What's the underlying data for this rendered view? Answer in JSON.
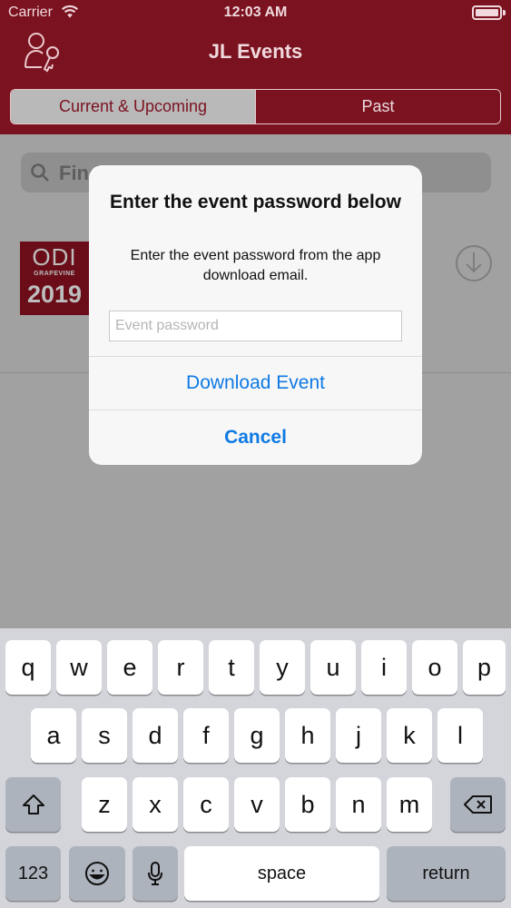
{
  "status_bar": {
    "carrier": "Carrier",
    "time": "12:03 AM"
  },
  "header": {
    "title": "JL Events"
  },
  "tabs": [
    {
      "label": "Current & Upcoming",
      "selected": true
    },
    {
      "label": "Past",
      "selected": false
    }
  ],
  "search": {
    "text": "Find"
  },
  "event": {
    "thumb_line1": "ODI",
    "thumb_line2": "GRAPEVINE",
    "thumb_line3": "2019"
  },
  "alert": {
    "title": "Enter the event password below",
    "message": "Enter the event password from the app download email.",
    "input_placeholder": "Event password",
    "input_value": "",
    "download_label": "Download Event",
    "cancel_label": "Cancel"
  },
  "keyboard": {
    "row1": [
      "q",
      "w",
      "e",
      "r",
      "t",
      "y",
      "u",
      "i",
      "o",
      "p"
    ],
    "row2": [
      "a",
      "s",
      "d",
      "f",
      "g",
      "h",
      "j",
      "k",
      "l"
    ],
    "row3": [
      "z",
      "x",
      "c",
      "v",
      "b",
      "n",
      "m"
    ],
    "numbers_label": "123",
    "space_label": "space",
    "return_label": "return"
  },
  "colors": {
    "brand": "#7b1220",
    "link": "#0f7ae3",
    "keyboard_bg": "#d3d5db"
  },
  "icons": {
    "profile": "user-key-icon",
    "search": "search-icon",
    "download": "download-circle-icon",
    "shift": "shift-icon",
    "backspace": "backspace-icon",
    "emoji": "emoji-icon",
    "mic": "microphone-icon"
  }
}
